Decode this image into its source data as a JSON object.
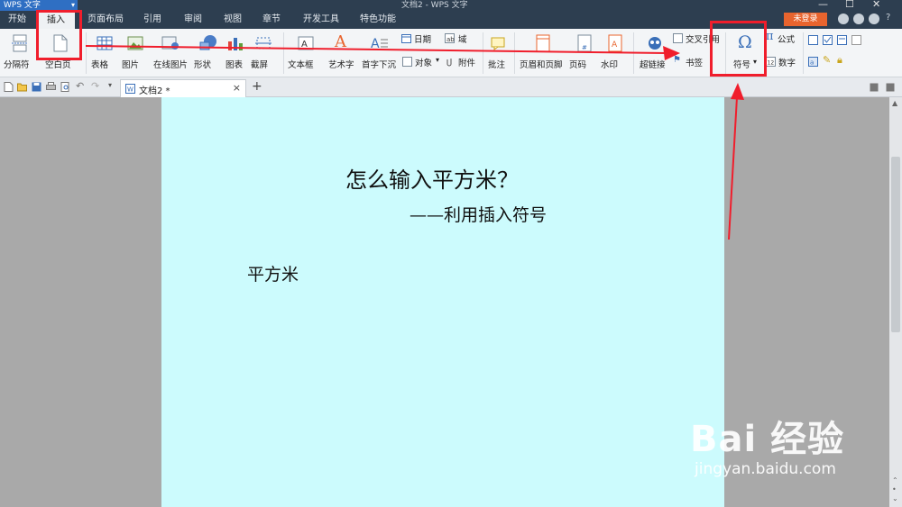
{
  "titlebar": {
    "app_name": "WPS 文字",
    "doc_title": "文档2 - WPS 文字",
    "window_controls": [
      "—",
      "☐",
      "✕"
    ]
  },
  "menu": {
    "items": [
      "开始",
      "插入",
      "页面布局",
      "引用",
      "审阅",
      "视图",
      "章节",
      "开发工具",
      "特色功能"
    ],
    "active_index": 1,
    "login_label": "未登录",
    "help_label": "?"
  },
  "ribbon": {
    "page_break": "分隔符",
    "blank_page": "空白页",
    "table": "表格",
    "picture": "图片",
    "online_picture": "在线图片",
    "shape": "形状",
    "chart": "图表",
    "screenshot": "截屏",
    "textbox": "文本框",
    "wordart": "艺术字",
    "dropcap": "首字下沉",
    "date": "日期",
    "field": "域",
    "object": "对象",
    "attachment": "附件",
    "comment": "批注",
    "header_footer": "页眉和页脚",
    "page_number": "页码",
    "watermark": "水印",
    "hyperlink": "超链接",
    "cross_ref": "交叉引用",
    "bookmark": "书签",
    "symbol": "符号",
    "formula": "公式",
    "number": "数字",
    "dropdown_mark": "▾"
  },
  "tabs": {
    "doc_tab": "文档2 *",
    "close": "×",
    "new_tab": "+"
  },
  "document": {
    "title": "怎么输入平方米？",
    "subtitle": "——利用插入符号",
    "body": "平方米"
  },
  "watermark": {
    "brand": "Bai 经验",
    "url": "jingyan.baidu.com"
  },
  "colors": {
    "page_bg": "#ccfbfd",
    "titlebar": "#2d3e50",
    "annotation": "#f01e2c",
    "login": "#e8642e"
  }
}
